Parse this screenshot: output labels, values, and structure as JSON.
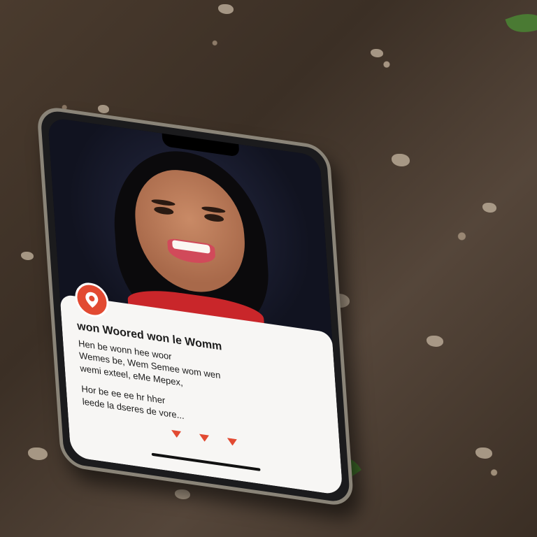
{
  "card": {
    "title": "won Woored won le Womm",
    "lines": [
      "Hen be wonn hee woor",
      "Wemes be, Wem Semee wom wen",
      "wemi exteel, eMe Mepex,",
      "Hor be ee ee hr hher",
      "leede la dseres de vore..."
    ]
  },
  "colors": {
    "accent": "#e24a32",
    "card_bg": "#f7f6f4",
    "phone_frame": "#8a8478",
    "ground": "#4a3b2e"
  },
  "icons": [
    "location-pin-icon",
    "triangle-icon",
    "triangle-icon",
    "triangle-icon"
  ]
}
